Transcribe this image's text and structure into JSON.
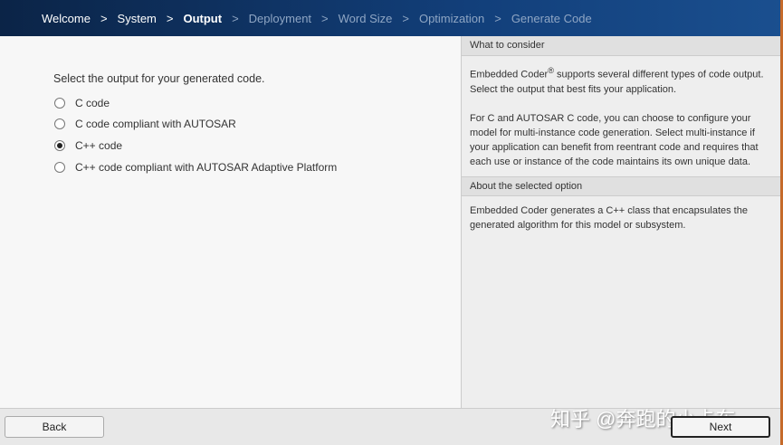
{
  "breadcrumb": [
    "Welcome",
    "System",
    "Output",
    "Deployment",
    "Word Size",
    "Optimization",
    "Generate Code"
  ],
  "separator": ">",
  "main": {
    "prompt": "Select the output for your generated code.",
    "options": [
      {
        "label": "C code",
        "selected": false
      },
      {
        "label": "C code compliant with AUTOSAR",
        "selected": false
      },
      {
        "label": "C++ code",
        "selected": true
      },
      {
        "label": "C++ code compliant with AUTOSAR Adaptive Platform",
        "selected": false
      }
    ]
  },
  "help": {
    "consider_title": "What to consider",
    "consider_p1a": "Embedded Coder",
    "consider_reg": "®",
    "consider_p1b": " supports several different types of code output. Select the output that best fits your application.",
    "consider_p2": "For C and AUTOSAR C code, you can choose to configure your model for multi-instance code generation. Select multi-instance if your application can benefit from reentrant code and requires that each use or instance of the code maintains its own unique data.",
    "about_title": "About the selected option",
    "about_text": "Embedded Coder generates a C++ class that encapsulates the generated algorithm for this model or subsystem."
  },
  "footer": {
    "back": "Back",
    "next": "Next"
  },
  "watermark": "知乎 @奔跑的小卡车"
}
